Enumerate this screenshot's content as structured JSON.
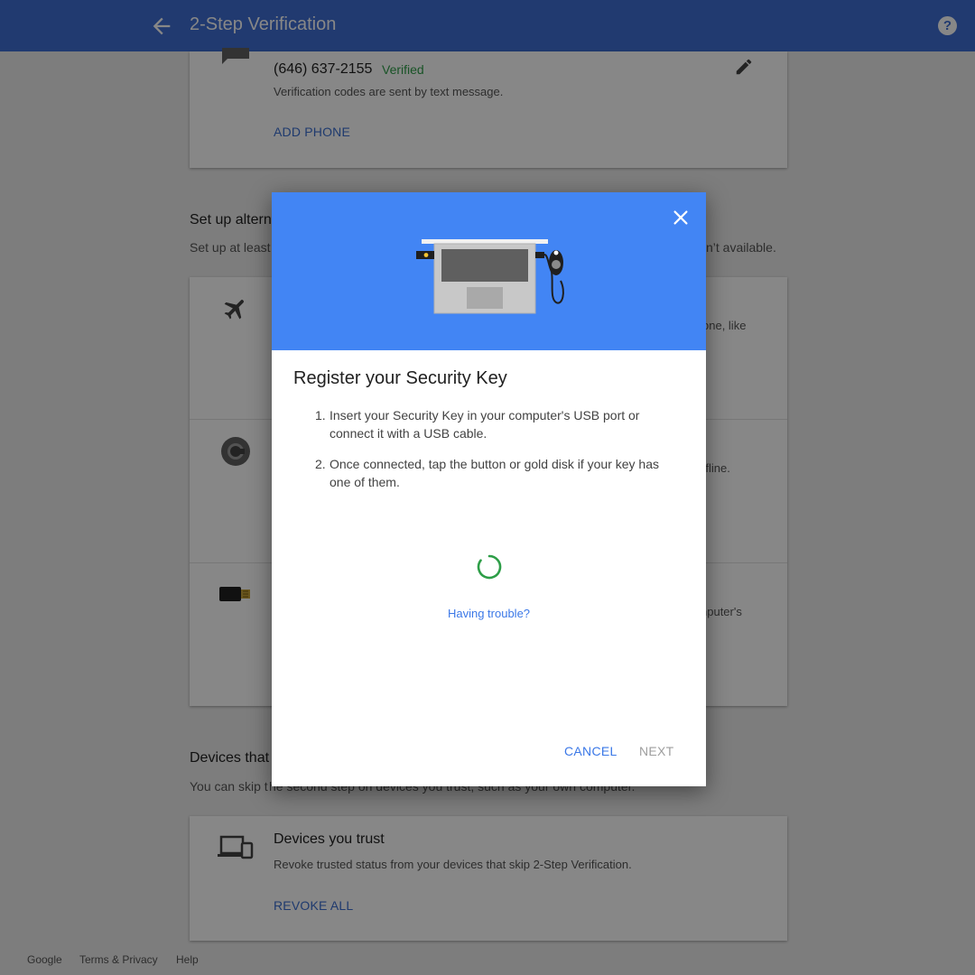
{
  "header": {
    "title": "2-Step Verification",
    "back_icon": "arrow-back-icon",
    "help_label": "?"
  },
  "phone_card": {
    "number": "(646) 637-2155",
    "status": "Verified",
    "description": "Verification codes are sent by text message.",
    "add_phone": "ADD PHONE"
  },
  "alternate": {
    "title_partial": "Set up altern",
    "desc_partial": "Set up at least",
    "desc_tail": "n’t available.",
    "rows": [
      {
        "icon": "airplane-icon",
        "text_tail": "one, like"
      },
      {
        "icon": "authenticator-icon",
        "text_tail": "ffline."
      },
      {
        "icon": "security-key-icon",
        "text_tail": "nputer's"
      }
    ]
  },
  "devices_section": {
    "title_partial": "Devices that",
    "desc_left": "You can skip t",
    "desc_right": "he second step on devices you trust, such as your own computer."
  },
  "devices_card": {
    "title": "Devices you trust",
    "description": "Revoke trusted status from your devices that skip 2-Step Verification.",
    "revoke": "REVOKE ALL"
  },
  "footer": {
    "links": [
      "Google",
      "Terms & Privacy",
      "Help"
    ]
  },
  "dialog": {
    "title": "Register your Security Key",
    "steps": [
      {
        "num": "1.",
        "text": "Insert your Security Key in your computer's USB port or connect it with a USB cable."
      },
      {
        "num": "2.",
        "text": "Once connected, tap the button or gold disk if your key has one of them."
      }
    ],
    "trouble_link": "Having trouble?",
    "cancel_label": "CANCEL",
    "next_label": "NEXT",
    "colors": {
      "header_bg": "#4285f4",
      "spinner": "#2e9e48",
      "link": "#3b78e7",
      "disabled": "#9e9e9e"
    }
  }
}
